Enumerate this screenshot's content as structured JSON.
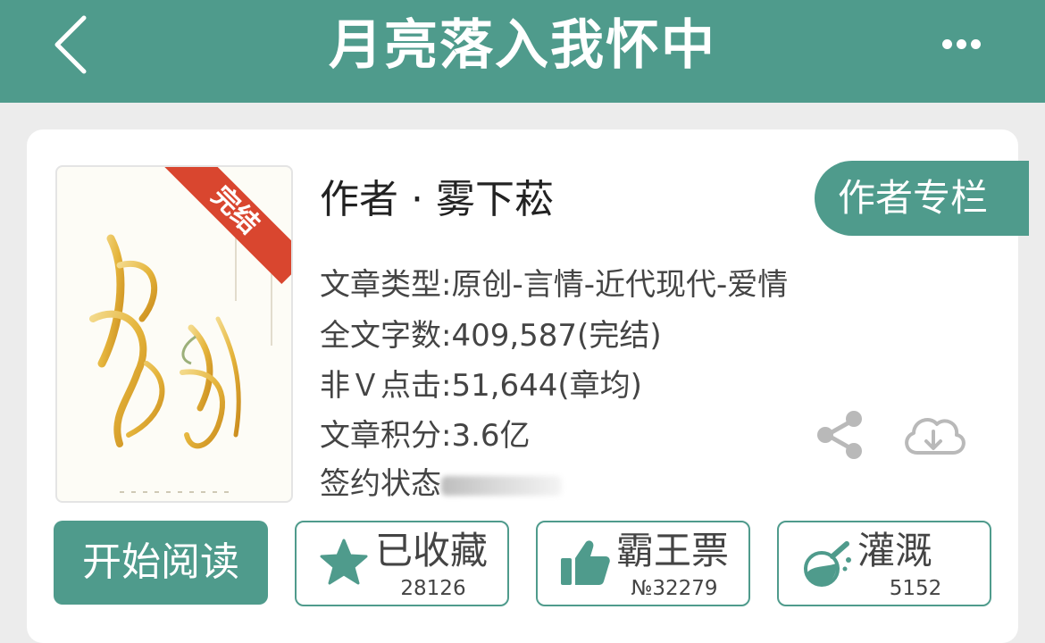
{
  "header": {
    "title": "月亮落入我怀中",
    "back_icon": "chevron-left-icon",
    "more_icon": "more-dots-icon"
  },
  "book": {
    "cover": {
      "ribbon": "完结",
      "art_title": "月亮落入我怀中"
    },
    "author_line": "作者 · 雾下菘",
    "author_column_button": "作者专栏",
    "info": {
      "type": "文章类型:原创-言情-近代现代-爱情",
      "word_count": "全文字数:409,587(完结)",
      "clicks": "非Ｖ点击:51,644(章均)",
      "score": "文章积分:3.6亿",
      "contract_label": "签约状态"
    },
    "share_icon": "share-icon",
    "download_icon": "cloud-download-icon"
  },
  "actions": {
    "start_reading": "开始阅读",
    "collect": {
      "label": "已收藏",
      "count": "28126",
      "icon": "star-icon"
    },
    "vote": {
      "label": "霸王票",
      "count": "№32279",
      "icon": "thumbs-up-icon"
    },
    "nourish": {
      "label": "灌溉",
      "count": "5152",
      "icon": "flask-icon"
    }
  },
  "colors": {
    "accent": "#4f9b8c",
    "ribbon": "#d9462f",
    "background": "#ececec"
  }
}
